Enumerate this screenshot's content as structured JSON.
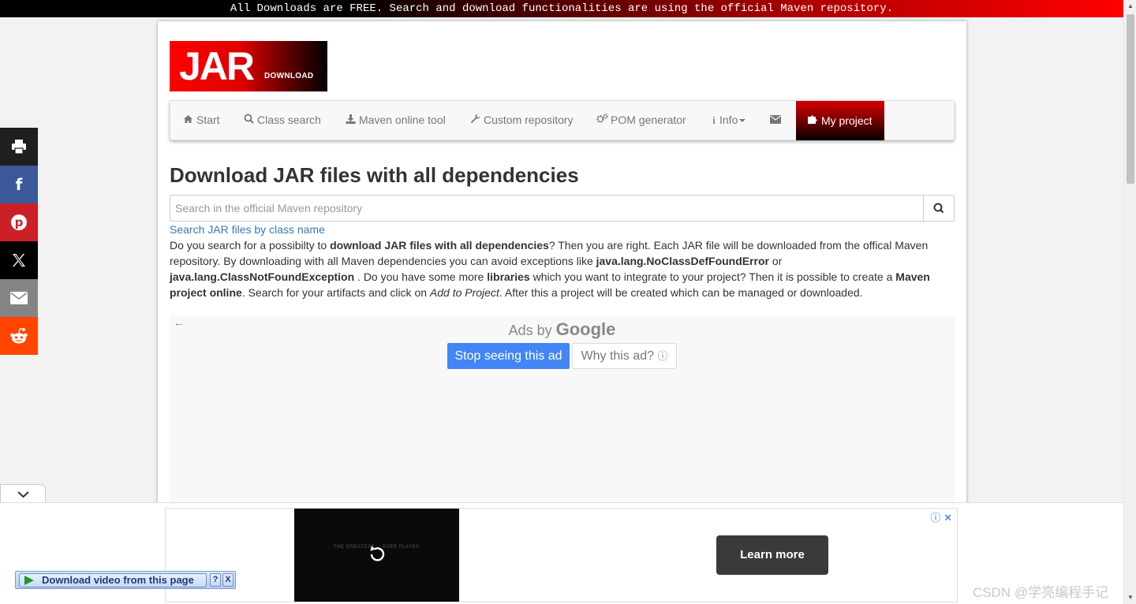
{
  "banner": {
    "text": "All Downloads are FREE. Search and download functionalities are using the official Maven repository."
  },
  "logo": {
    "main": "JAR",
    "sub": "DOWNLOAD"
  },
  "nav": {
    "items": [
      {
        "label": "Start",
        "icon": "home-icon"
      },
      {
        "label": "Class search",
        "icon": "search-icon"
      },
      {
        "label": "Maven online tool",
        "icon": "download-icon"
      },
      {
        "label": "Custom repository",
        "icon": "wrench-icon"
      },
      {
        "label": "POM generator",
        "icon": "gears-icon"
      },
      {
        "label": "Info",
        "icon": "info-icon"
      },
      {
        "label": "",
        "icon": "envelope-icon"
      },
      {
        "label": "My project",
        "icon": "puzzle-icon"
      }
    ]
  },
  "main": {
    "heading": "Download JAR files with all dependencies",
    "search_placeholder": "Search in the official Maven repository",
    "class_link": "Search JAR files by class name",
    "intro": {
      "p1": "Do you search for a possibilty to ",
      "b1": "download JAR files with all dependencies",
      "p2": "? Then you are right. Each JAR file will be downloaded from the offical Maven repository. By downloading with all Maven dependencies you can avoid exceptions like ",
      "b2": "java.lang.NoClassDefFoundError",
      "p3": " or ",
      "b3": "java.lang.ClassNotFoundException",
      "p4": " . Do you have some more ",
      "b4": "libraries",
      "p5": " which you want to integrate to your project? Then it is possible to create a ",
      "b5": "Maven project online",
      "p6": ". Search for your artifacts and click on ",
      "i1": "Add to Project",
      "p7": ". After this a project will be created which can be managed or downloaded."
    }
  },
  "ad": {
    "ads_by": "Ads by",
    "google": "Google",
    "stop_label": "Stop seeing this ad",
    "why_label": "Why this ad?",
    "why_icon": "ⓘ"
  },
  "share": {
    "buttons": [
      {
        "name": "print",
        "color": "#1f1f1f"
      },
      {
        "name": "facebook",
        "color": "#3b5998"
      },
      {
        "name": "pinterest",
        "color": "#cb2027"
      },
      {
        "name": "x",
        "color": "#000000"
      },
      {
        "name": "email",
        "color": "#848484"
      },
      {
        "name": "reddit",
        "color": "#ff4500"
      }
    ]
  },
  "bottom_ad": {
    "video_caption": "THE GREATEST ... EVER PLAYED",
    "learn_more": "Learn more",
    "adchoices": "ⓘ ✕"
  },
  "download_video": {
    "label": "Download video from this page",
    "help": "?",
    "close": "X"
  },
  "watermark": "CSDN @学亮编程手记"
}
